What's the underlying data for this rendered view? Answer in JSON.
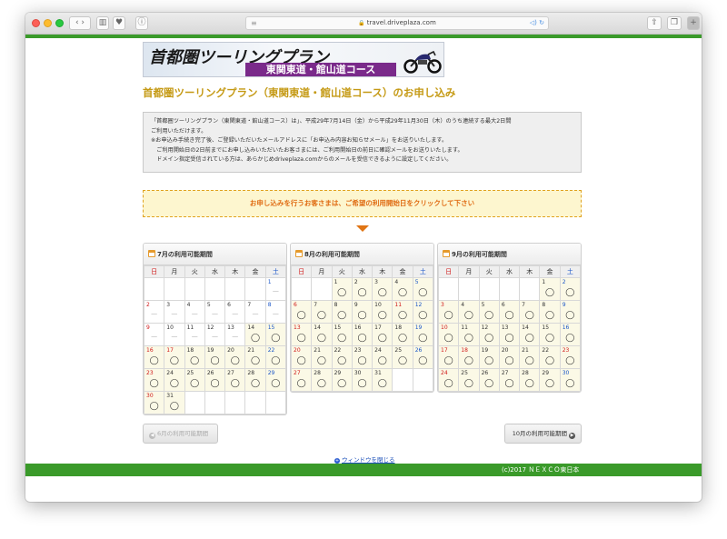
{
  "browser": {
    "url": "travel.driveplaza.com"
  },
  "banner": {
    "main_text": "首都圏ツーリングプラン",
    "sub_text": "東関東道・館山道コース"
  },
  "page_title": "首都圏ツーリングプラン（東関東道・館山道コース）のお申し込み",
  "info_lines": [
    "「首都圏ツーリングプラン（東関東道・館山道コース）は」、平成29年7月14日（金）から平成29年11月30日（木）のうち連続する最大2日間",
    "ご利用いただけます。",
    "※お申込み手続き完了後、ご登録いただいたメールアドレスに「お申込み内容お知らせメール」をお送りいたします。",
    "　ご利用開始日の2日前までにお申し込みいただいたお客さまには、ご利用開始日の前日に確認メールをお送りいたします。",
    "　ドメイン指定受信されている方は、あらかじめdriveplaza.comからのメールを受信できるように設定してください。"
  ],
  "notice": "お申し込みを行うお客さまは、ご希望の利用開始日をクリックして下さい",
  "weekdays": [
    "日",
    "月",
    "火",
    "水",
    "木",
    "金",
    "土"
  ],
  "calendars": [
    {
      "title": "7月の利用可能期間",
      "weeks": [
        [
          null,
          null,
          null,
          null,
          null,
          null,
          {
            "d": "1",
            "s": "-"
          }
        ],
        [
          {
            "d": "2",
            "s": "-"
          },
          {
            "d": "3",
            "s": "-"
          },
          {
            "d": "4",
            "s": "-"
          },
          {
            "d": "5",
            "s": "-"
          },
          {
            "d": "6",
            "s": "-"
          },
          {
            "d": "7",
            "s": "-"
          },
          {
            "d": "8",
            "s": "-"
          }
        ],
        [
          {
            "d": "9",
            "s": "-"
          },
          {
            "d": "10",
            "s": "-"
          },
          {
            "d": "11",
            "s": "-"
          },
          {
            "d": "12",
            "s": "-"
          },
          {
            "d": "13",
            "s": "-"
          },
          {
            "d": "14",
            "s": "o"
          },
          {
            "d": "15",
            "s": "o"
          }
        ],
        [
          {
            "d": "16",
            "s": "o"
          },
          {
            "d": "17",
            "s": "o"
          },
          {
            "d": "18",
            "s": "o"
          },
          {
            "d": "19",
            "s": "o"
          },
          {
            "d": "20",
            "s": "o"
          },
          {
            "d": "21",
            "s": "o"
          },
          {
            "d": "22",
            "s": "o"
          }
        ],
        [
          {
            "d": "23",
            "s": "o"
          },
          {
            "d": "24",
            "s": "o"
          },
          {
            "d": "25",
            "s": "o"
          },
          {
            "d": "26",
            "s": "o"
          },
          {
            "d": "27",
            "s": "o"
          },
          {
            "d": "28",
            "s": "o"
          },
          {
            "d": "29",
            "s": "o"
          }
        ],
        [
          {
            "d": "30",
            "s": "o"
          },
          {
            "d": "31",
            "s": "o"
          },
          null,
          null,
          null,
          null,
          null
        ]
      ]
    },
    {
      "title": "8月の利用可能期間",
      "weeks": [
        [
          null,
          null,
          {
            "d": "1",
            "s": "o"
          },
          {
            "d": "2",
            "s": "o"
          },
          {
            "d": "3",
            "s": "o"
          },
          {
            "d": "4",
            "s": "o"
          },
          {
            "d": "5",
            "s": "o"
          }
        ],
        [
          {
            "d": "6",
            "s": "o"
          },
          {
            "d": "7",
            "s": "o"
          },
          {
            "d": "8",
            "s": "o"
          },
          {
            "d": "9",
            "s": "o"
          },
          {
            "d": "10",
            "s": "o"
          },
          {
            "d": "11",
            "s": "o"
          },
          {
            "d": "12",
            "s": "o"
          }
        ],
        [
          {
            "d": "13",
            "s": "o"
          },
          {
            "d": "14",
            "s": "o"
          },
          {
            "d": "15",
            "s": "o"
          },
          {
            "d": "16",
            "s": "o"
          },
          {
            "d": "17",
            "s": "o"
          },
          {
            "d": "18",
            "s": "o"
          },
          {
            "d": "19",
            "s": "o"
          }
        ],
        [
          {
            "d": "20",
            "s": "o"
          },
          {
            "d": "21",
            "s": "o"
          },
          {
            "d": "22",
            "s": "o"
          },
          {
            "d": "23",
            "s": "o"
          },
          {
            "d": "24",
            "s": "o"
          },
          {
            "d": "25",
            "s": "o"
          },
          {
            "d": "26",
            "s": "o"
          }
        ],
        [
          {
            "d": "27",
            "s": "o"
          },
          {
            "d": "28",
            "s": "o"
          },
          {
            "d": "29",
            "s": "o"
          },
          {
            "d": "30",
            "s": "o"
          },
          {
            "d": "31",
            "s": "o"
          },
          null,
          null
        ]
      ]
    },
    {
      "title": "9月の利用可能期間",
      "weeks": [
        [
          null,
          null,
          null,
          null,
          null,
          {
            "d": "1",
            "s": "o"
          },
          {
            "d": "2",
            "s": "o"
          }
        ],
        [
          {
            "d": "3",
            "s": "o"
          },
          {
            "d": "4",
            "s": "o"
          },
          {
            "d": "5",
            "s": "o"
          },
          {
            "d": "6",
            "s": "o"
          },
          {
            "d": "7",
            "s": "o"
          },
          {
            "d": "8",
            "s": "o"
          },
          {
            "d": "9",
            "s": "o"
          }
        ],
        [
          {
            "d": "10",
            "s": "o"
          },
          {
            "d": "11",
            "s": "o"
          },
          {
            "d": "12",
            "s": "o"
          },
          {
            "d": "13",
            "s": "o"
          },
          {
            "d": "14",
            "s": "o"
          },
          {
            "d": "15",
            "s": "o"
          },
          {
            "d": "16",
            "s": "o"
          }
        ],
        [
          {
            "d": "17",
            "s": "o"
          },
          {
            "d": "18",
            "s": "o"
          },
          {
            "d": "19",
            "s": "o"
          },
          {
            "d": "20",
            "s": "o"
          },
          {
            "d": "21",
            "s": "o"
          },
          {
            "d": "22",
            "s": "o"
          },
          {
            "d": "23",
            "s": "o"
          }
        ],
        [
          {
            "d": "24",
            "s": "o"
          },
          {
            "d": "25",
            "s": "o"
          },
          {
            "d": "26",
            "s": "o"
          },
          {
            "d": "27",
            "s": "o"
          },
          {
            "d": "28",
            "s": "o"
          },
          {
            "d": "29",
            "s": "o"
          },
          {
            "d": "30",
            "s": "o"
          }
        ]
      ]
    }
  ],
  "holidays": [
    "7-17",
    "8-11",
    "9-18",
    "9-23"
  ],
  "prev_button": "6月の利用可能期間",
  "next_button": "10月の利用可能期間",
  "close_link": "ウィンドウを閉じる",
  "footer": "(c)2017 ＮＥＸＣＯ東日本",
  "colors": {
    "green": "#3a9a2a",
    "title_gold": "#c59a15",
    "notice_orange": "#e06d15",
    "sunday": "#d01818",
    "saturday": "#1a56c8"
  }
}
